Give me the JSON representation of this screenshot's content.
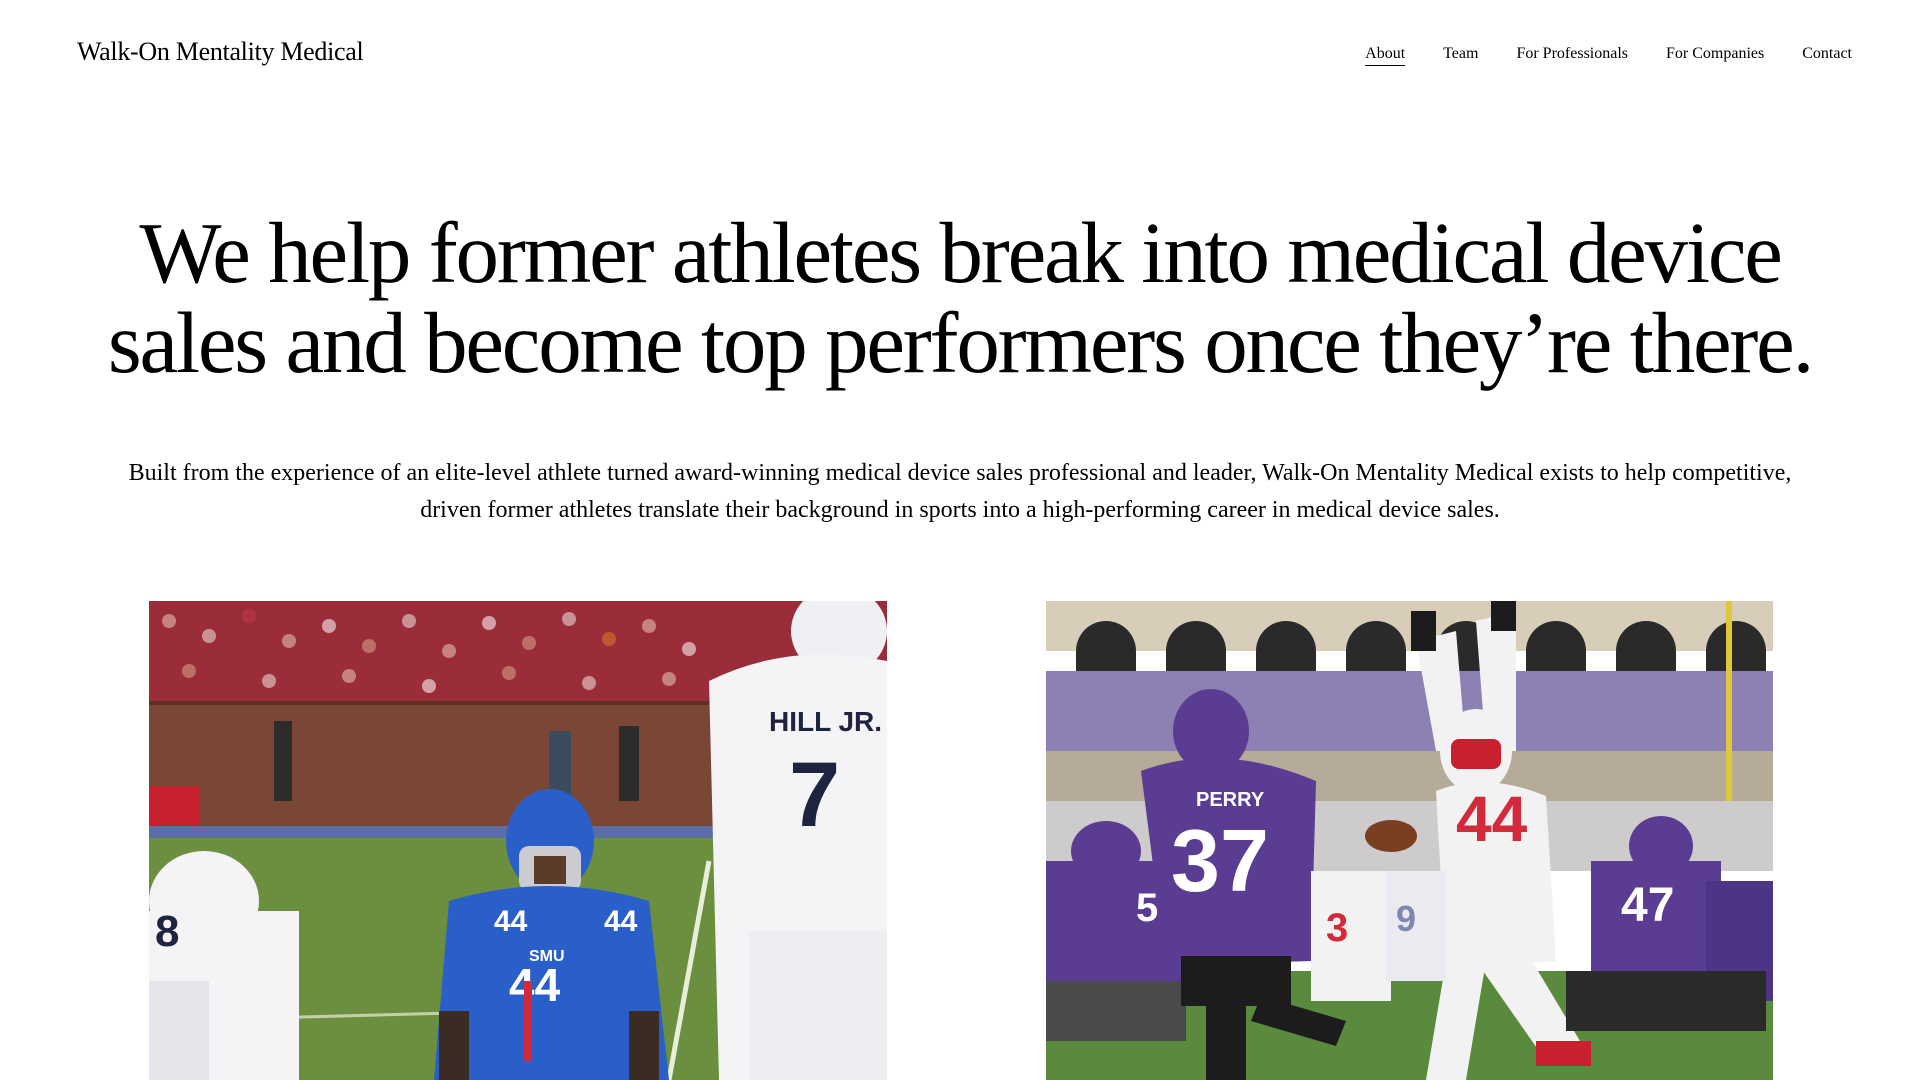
{
  "header": {
    "brand": "Walk-On Mentality Medical",
    "nav": [
      {
        "label": "About",
        "active": true
      },
      {
        "label": "Team"
      },
      {
        "label": "For Professionals"
      },
      {
        "label": "For Companies"
      },
      {
        "label": "Contact"
      }
    ]
  },
  "hero": {
    "headline_line1": "We help former athletes break into medical device",
    "headline_line2": "sales and become top performers once they’re there.",
    "subtext_line1": "Built from the experience of an elite-level athlete turned award-winning medical device sales professional and leader, Walk-On Mentality Medical exists to help competitive,",
    "subtext_line2": "driven former athletes translate their background in sports into a high-performing career in medical device sales."
  },
  "photos": {
    "left": {
      "jersey_front": "44",
      "jersey_team": "SMU",
      "opponent_name": "HILL JR.",
      "opponent_number": "7",
      "colors": {
        "smu_blue": "#2a5fc9",
        "smu_red": "#d22a3a",
        "field": "#5f8a3a"
      }
    },
    "right": {
      "purple_name": "PERRY",
      "purple_number": "37",
      "red_number": "44",
      "colors": {
        "tcu_purple": "#5a3d92",
        "field": "#4f7f3a",
        "white_jersey": "#f2f2f2"
      }
    }
  }
}
